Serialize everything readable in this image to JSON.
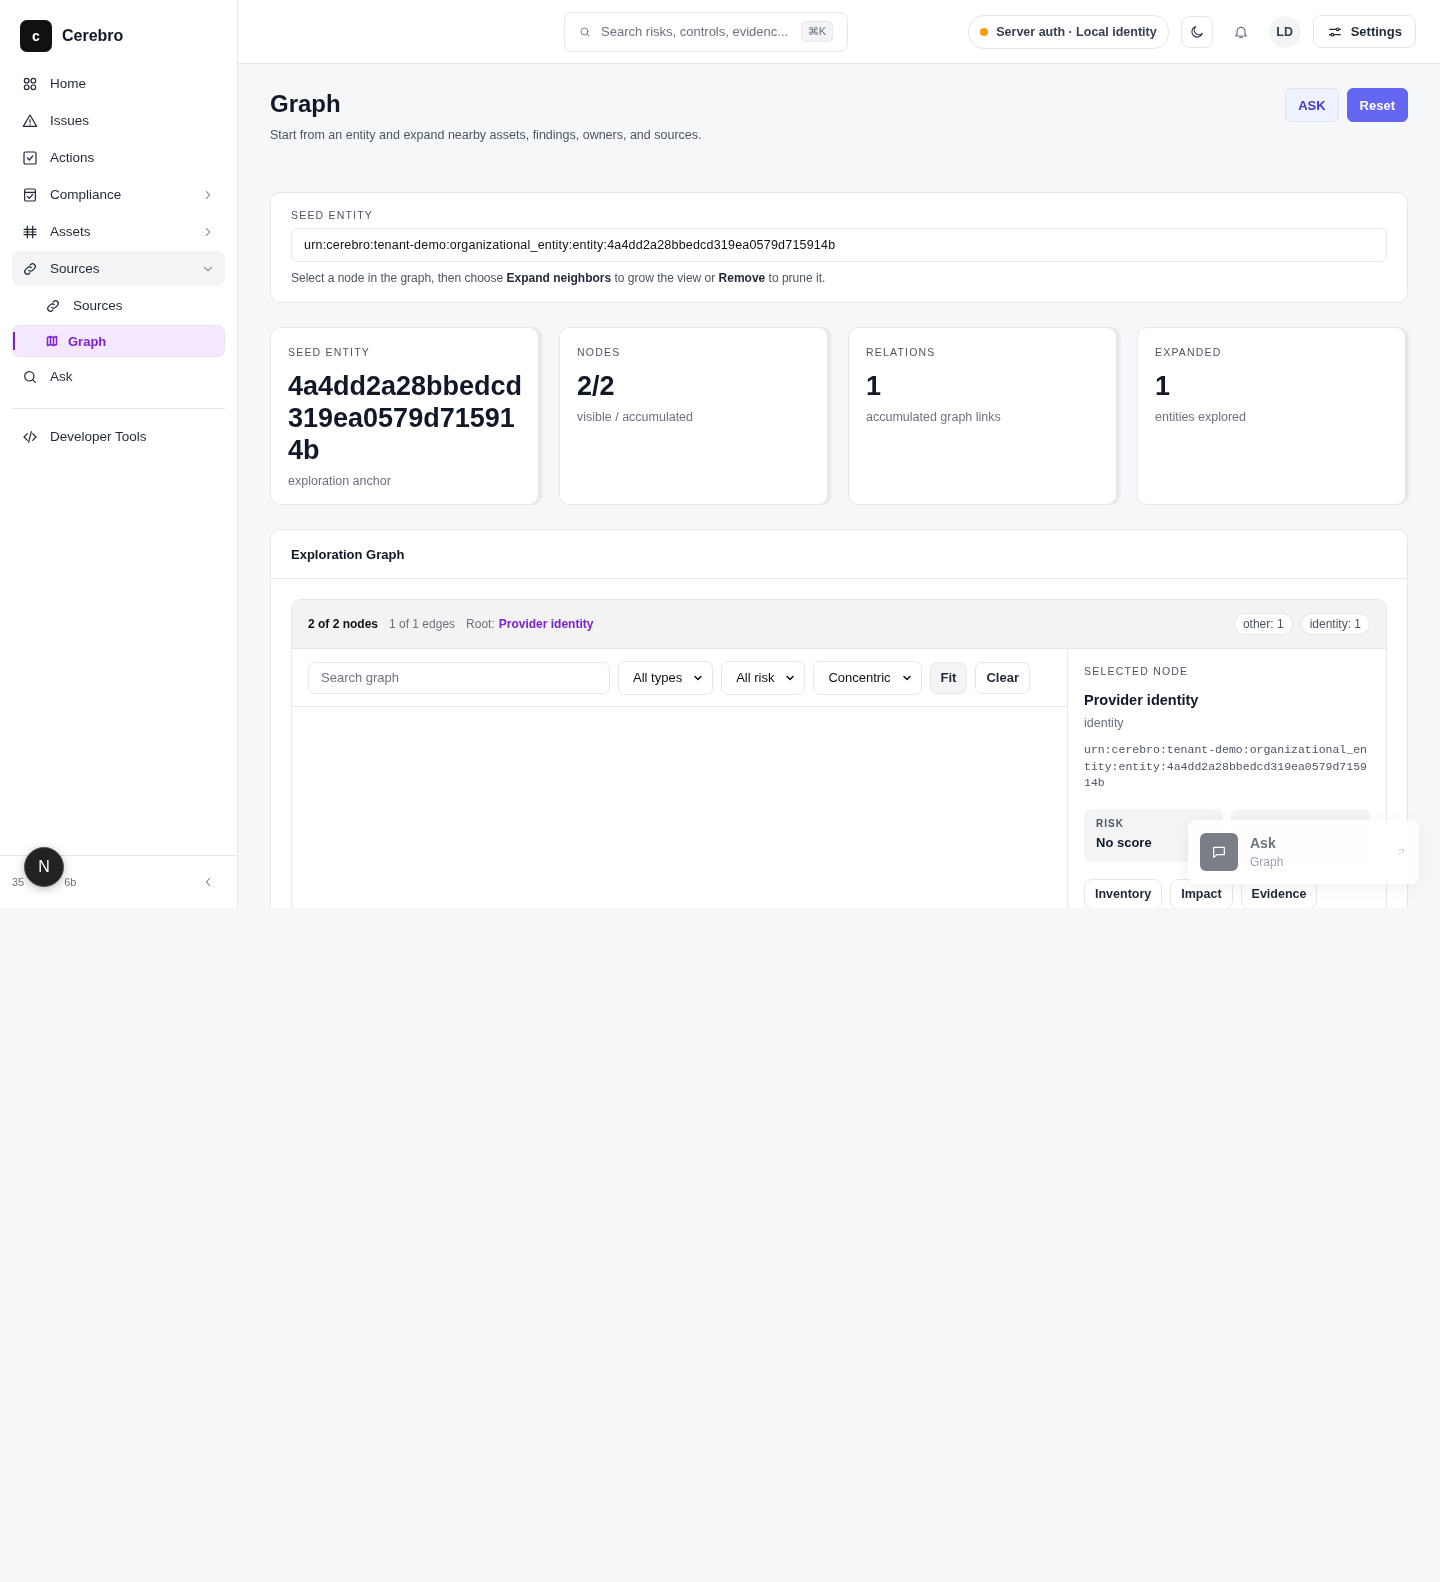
{
  "app": {
    "logo_letter": "c",
    "name": "Cerebro"
  },
  "sidebar": {
    "items": [
      {
        "label": "Home",
        "kind": "link",
        "selected": false
      },
      {
        "label": "Issues",
        "kind": "link",
        "selected": false
      },
      {
        "label": "Actions",
        "kind": "link",
        "selected": false
      },
      {
        "label": "Compliance",
        "kind": "group",
        "expanded": false,
        "selected": false
      },
      {
        "label": "Assets",
        "kind": "group",
        "expanded": false,
        "selected": false
      },
      {
        "label": "Sources",
        "kind": "group",
        "expanded": true,
        "selected": false,
        "children": [
          {
            "label": "Sources",
            "selected": false
          },
          {
            "label": "Graph",
            "selected": true
          }
        ]
      },
      {
        "label": "Ask",
        "kind": "link",
        "selected": false
      }
    ],
    "tools": {
      "label": "Developer Tools"
    },
    "footer": {
      "text_before": "35",
      "text_after": "6b",
      "badge": "N"
    }
  },
  "topbar": {
    "search": {
      "placeholder": "Search risks, controls, evidenc...",
      "shortcut": "⌘K"
    },
    "status": "Server auth · Local identity",
    "avatar": "LD",
    "settings": "Settings"
  },
  "header": {
    "title": "Graph",
    "subtitle": "Start from an entity and expand nearby assets, findings, owners, and sources.",
    "buttons": [
      {
        "label": "ASK",
        "kind": "secondary"
      },
      {
        "label": "Reset",
        "kind": "primary"
      }
    ]
  },
  "seed": {
    "label": "SEED ENTITY",
    "value": "urn:cerebro:tenant-demo:organizational_entity:entity:4a4dd2a28bbedcd319ea0579d715914b",
    "help": "Select a node in the graph, then choose **Expand neighbors** to grow the view or **Remove** to prune it."
  },
  "stats": [
    {
      "label": "SEED ENTITY",
      "value": "4a4dd2a28bbedcd319ea0579d715914b",
      "caption": "exploration anchor"
    },
    {
      "label": "NODES",
      "value": "2/2",
      "caption": "visible / accumulated"
    },
    {
      "label": "RELATIONS",
      "value": "1",
      "caption": "accumulated graph links"
    },
    {
      "label": "EXPANDED",
      "value": "1",
      "caption": "entities explored"
    }
  ],
  "graph": {
    "title": "Exploration Graph",
    "summary": {
      "nodes": "2 of 2 nodes",
      "edges": "1 of 1 edges",
      "root_label": "Root:",
      "root": "Provider identity"
    },
    "chips": [
      "other: 1",
      "identity: 1"
    ],
    "search": {
      "placeholder": "Search graph"
    },
    "selects": [
      "All types",
      "All risk",
      "Concentric"
    ],
    "buttons": [
      {
        "label": "Fit",
        "kind": "muted"
      },
      {
        "label": "Clear",
        "kind": "outline"
      }
    ],
    "selected_node": {
      "heading": "SELECTED NODE",
      "name": "Provider identity",
      "type": "identity",
      "urn": "urn:cerebro:tenant-demo:organizational_entity:entity:4a4dd2a28bbedcd319ea0579d715914b",
      "metrics": [
        {
          "label": "RISK",
          "value": "No score"
        }
      ],
      "actions": [
        "Inventory",
        "Impact",
        "Evidence"
      ]
    }
  },
  "toast": {
    "title": "Ask",
    "subtitle": "Graph"
  }
}
